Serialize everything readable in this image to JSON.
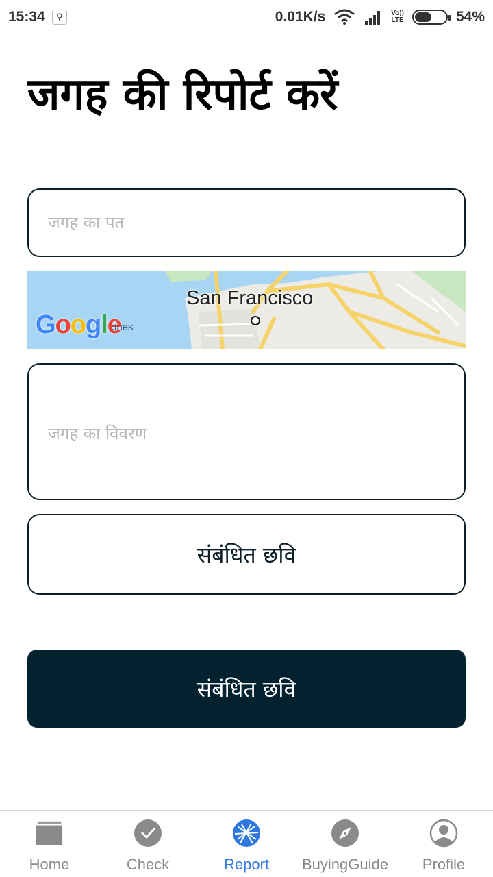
{
  "status_bar": {
    "time": "15:34",
    "net_speed": "0.01K/s",
    "network_type_top": "Vo))",
    "network_type_bottom": "LTE",
    "battery_percent": "54%",
    "battery_level": 0.54
  },
  "page": {
    "title": "जगह की रिपोर्ट करें"
  },
  "form": {
    "address_placeholder": "जगह का पत",
    "address_value": "",
    "description_placeholder": "जगह का विवरण",
    "description_value": "",
    "image_button_label": "संबंधित छवि",
    "submit_button_label": "संबंधित छवि"
  },
  "map": {
    "city_label": "San Francisco",
    "logo": "Google",
    "sublabel": "ones"
  },
  "bottom_nav": {
    "items": [
      {
        "label": "Home",
        "icon": "home-icon",
        "active": false
      },
      {
        "label": "Check",
        "icon": "check-icon",
        "active": false
      },
      {
        "label": "Report",
        "icon": "report-icon",
        "active": true
      },
      {
        "label": "BuyingGuide",
        "icon": "compass-icon",
        "active": false
      },
      {
        "label": "Profile",
        "icon": "profile-icon",
        "active": false
      }
    ]
  },
  "colors": {
    "primary_dark": "#022230",
    "active_tab": "#2e78e0",
    "inactive_tab": "#8a8a8a"
  }
}
